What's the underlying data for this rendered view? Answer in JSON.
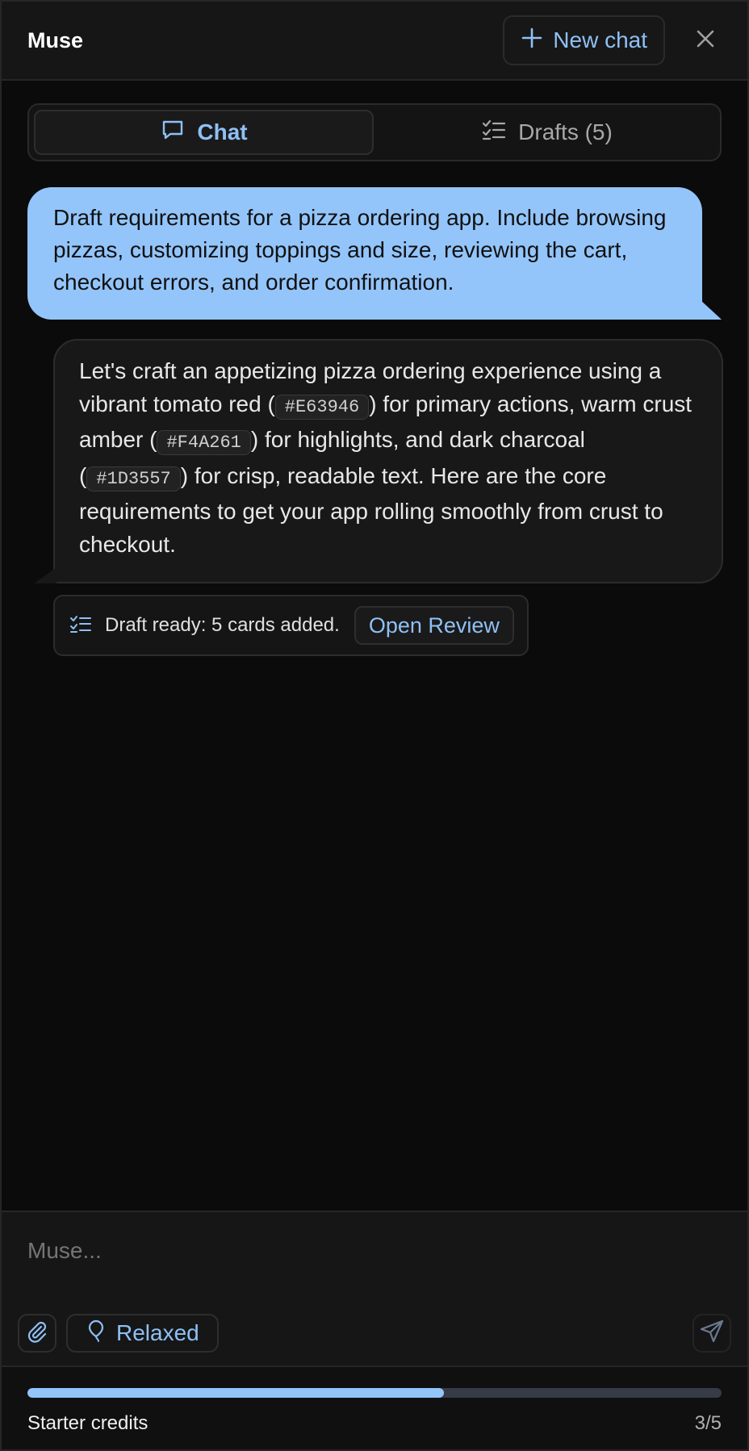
{
  "header": {
    "title": "Muse",
    "new_chat_label": "New chat",
    "close_icon": "close-icon"
  },
  "tabs": [
    {
      "label": "Chat",
      "icon": "chat-bubble-icon",
      "active": true
    },
    {
      "label": "Drafts (5)",
      "icon": "checklist-icon",
      "active": false
    }
  ],
  "messages": {
    "user": "Draft requirements for a pizza ordering app. Include browsing pizzas, customizing toppings and size, reviewing the cart, checkout errors, and order confirmation.",
    "assistant": {
      "part1": "Let's craft an appetizing pizza ordering experience using a vibrant tomato red (",
      "code1": "#E63946",
      "part2": ") for primary actions, warm crust amber (",
      "code2": "#F4A261",
      "part3": ") for highlights, and dark charcoal (",
      "code3": "#1D3557",
      "part4": ") for crisp, readable text. Here are the core requirements to get your app rolling smoothly from crust to checkout."
    }
  },
  "draft_card": {
    "label": "Draft ready: 5 cards added.",
    "button_label": "Open Review",
    "icon": "checklist-icon"
  },
  "composer": {
    "placeholder": "Muse...",
    "mode_label": "Relaxed",
    "attach_icon": "paperclip-icon",
    "mode_icon": "balloon-icon",
    "send_icon": "send-icon"
  },
  "credits": {
    "label": "Starter credits",
    "count": "3/5",
    "progress": 0.6
  },
  "colors": {
    "accent": "#8fc0f5",
    "user_bubble": "#93c5fb",
    "background": "#0b0b0b"
  }
}
